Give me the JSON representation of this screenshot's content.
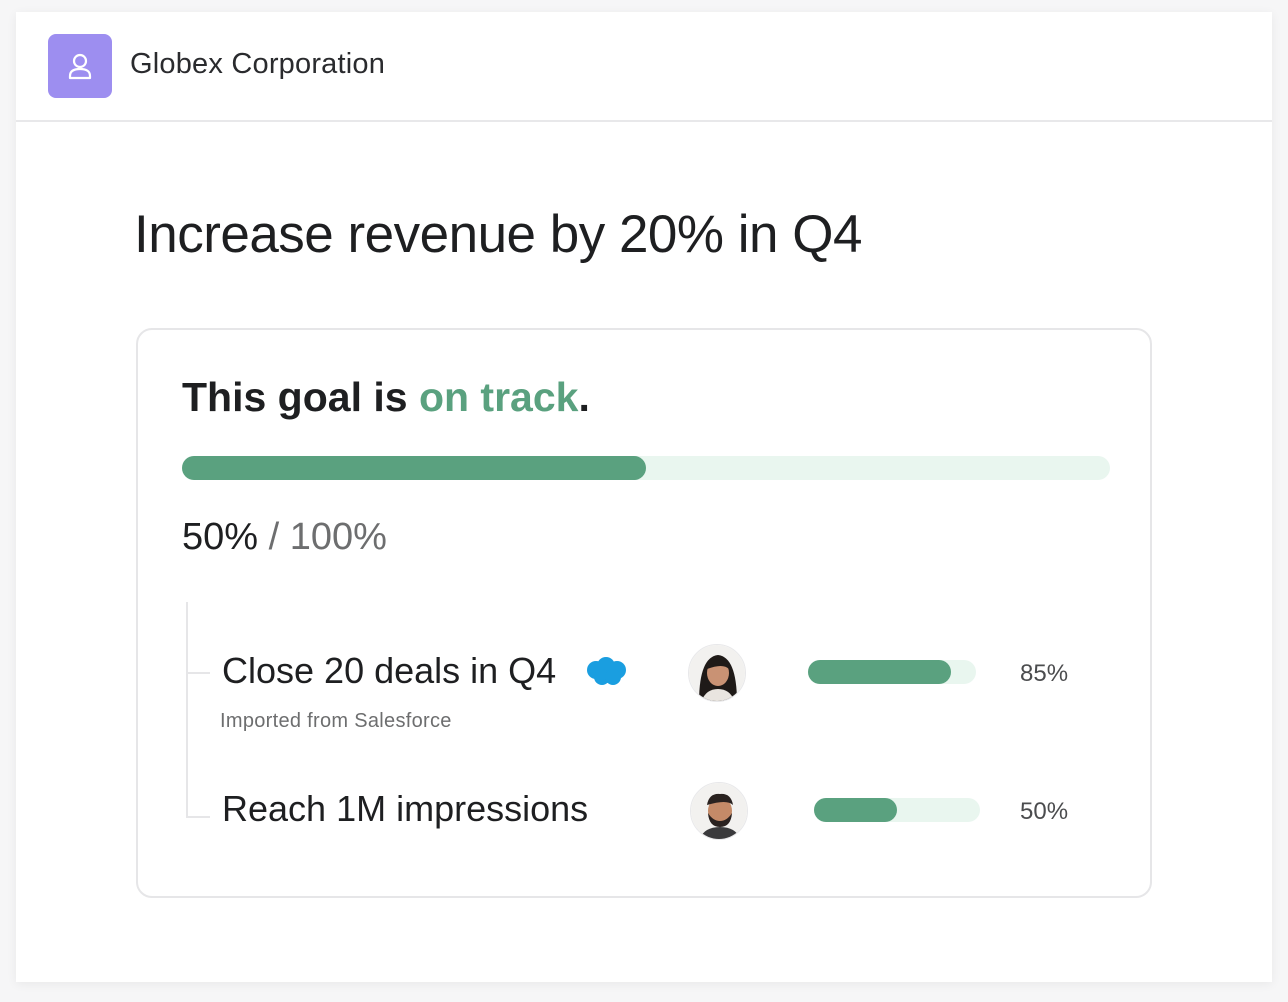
{
  "header": {
    "org_name": "Globex Corporation",
    "org_icon": "person-icon",
    "org_color": "#9d8ef0"
  },
  "goal": {
    "title": "Increase revenue by 20% in Q4",
    "status_prefix": "This goal is",
    "status_value": "on track",
    "status_suffix": ".",
    "status_color": "#5aa17f",
    "progress_fraction": 0.5,
    "progress_current": "50%",
    "progress_separator": "/",
    "progress_target": "100%"
  },
  "subgoals": [
    {
      "title": "Close 20 deals in Q4",
      "note": "Imported from Salesforce",
      "integration_icon": "salesforce-cloud-icon",
      "owner_icon": "avatar",
      "progress_fraction": 0.85,
      "percent_label": "85%"
    },
    {
      "title": "Reach 1M impressions",
      "owner_icon": "avatar",
      "progress_fraction": 0.5,
      "percent_label": "50%"
    }
  ]
}
